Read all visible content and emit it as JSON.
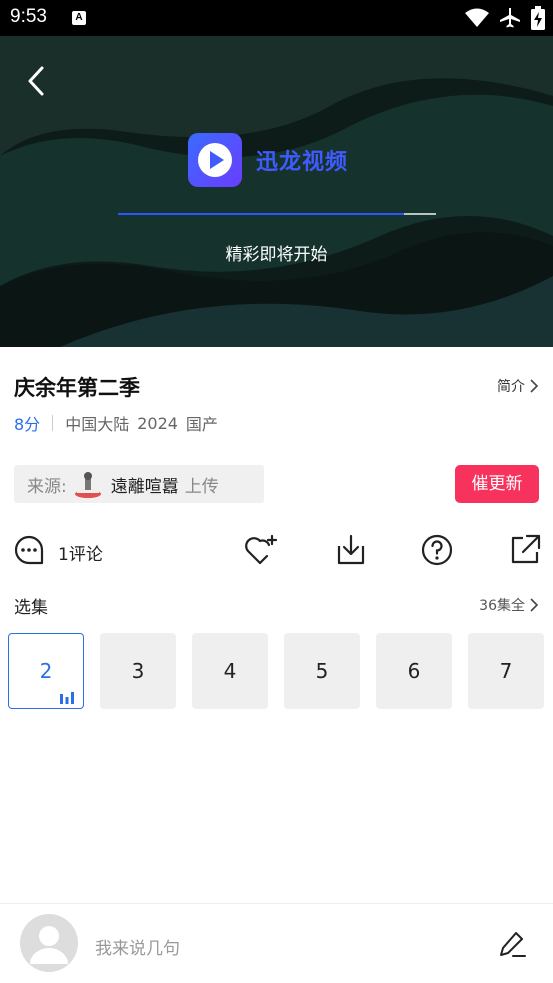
{
  "status_bar": {
    "time": "9:53",
    "notification_badge": "A",
    "icons": [
      "wifi-icon",
      "airplane-icon",
      "battery-charging-icon"
    ]
  },
  "player": {
    "brand_name": "迅龙视频",
    "loading_text": "精彩即将开始",
    "progress": 0.9
  },
  "show": {
    "title": "庆余年第二季",
    "intro_link": "简介",
    "score": "8分",
    "region": "中国大陆",
    "year": "2024",
    "origin": "国产"
  },
  "source": {
    "label": "来源:",
    "uploader": "遠離喧囂",
    "upload_suffix": "上传"
  },
  "urge_button": "催更新",
  "actions": {
    "comment_count": "1评论"
  },
  "episodes": {
    "title": "选集",
    "total": "36集全",
    "items": [
      "2",
      "3",
      "4",
      "5",
      "6",
      "7"
    ],
    "active_index": 0
  },
  "comment_bar": {
    "placeholder": "我来说几句"
  },
  "colors": {
    "accent_blue": "#2a6fe8",
    "urge_red": "#f7335d",
    "brand_blue": "#3f5bff"
  }
}
